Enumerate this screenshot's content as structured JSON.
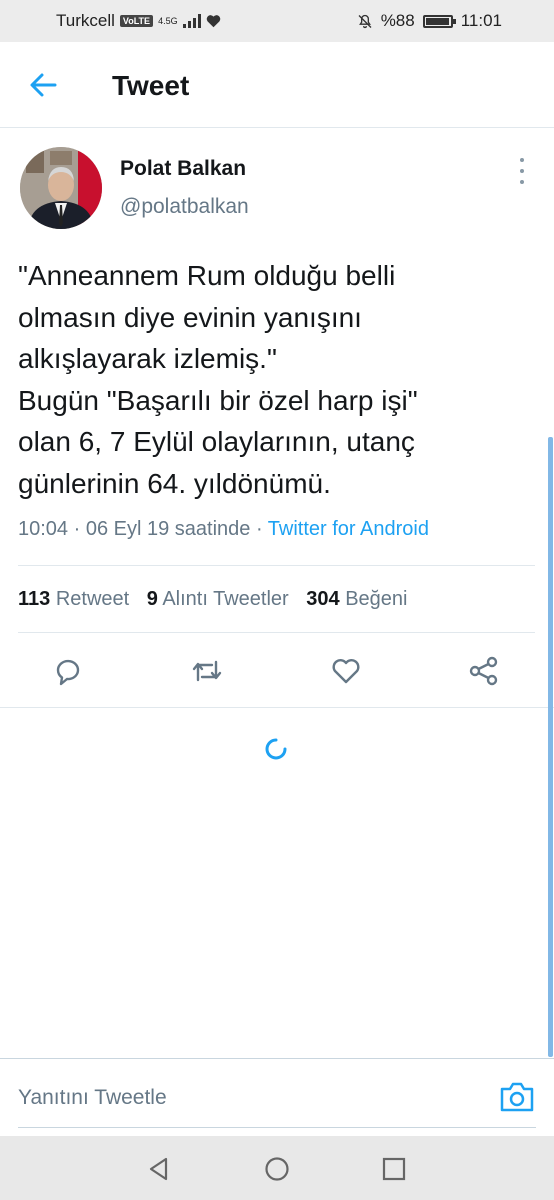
{
  "status_bar": {
    "carrier": "Turkcell",
    "volte": "VoLTE",
    "network": "4.5G",
    "battery": "%88",
    "battery_level": 0.88,
    "time": "11:01"
  },
  "header": {
    "title": "Tweet",
    "back_icon": "arrow-left-icon"
  },
  "author": {
    "name": "Polat Balkan",
    "handle": "@polatbalkan"
  },
  "tweet": {
    "lines": [
      "\"Anneannem Rum olduğu belli",
      "olmasın diye evinin yanışını",
      "alkışlayarak izlemiş.\"",
      "Bugün \"Başarılı bir özel harp işi\"",
      "olan 6, 7 Eylül olaylarının, utanç",
      "günlerinin 64. yıldönümü."
    ],
    "meta_time": "10:04 · 06 Eyl 19 saatinde · ",
    "source": "Twitter for Android"
  },
  "stats": {
    "retweets_count": "113",
    "retweets_label": "Retweet",
    "quotes_count": "9",
    "quotes_label": "Alıntı Tweetler",
    "likes_count": "304",
    "likes_label": "Beğeni"
  },
  "actions": [
    "reply-icon",
    "retweet-icon",
    "like-icon",
    "share-icon"
  ],
  "reply_bar": {
    "placeholder": "Yanıtını Tweetle",
    "icon": "camera-icon"
  },
  "colors": {
    "accent": "#1da1f2",
    "secondary_text": "#657786",
    "divider": "#e1e8ed"
  }
}
